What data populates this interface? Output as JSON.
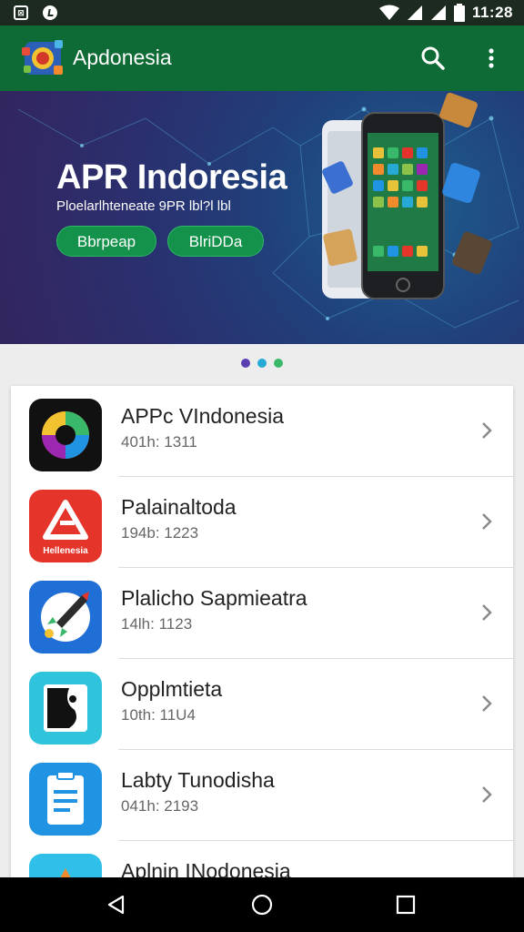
{
  "status_bar": {
    "time": "11:28"
  },
  "app_bar": {
    "title": "Apdonesia"
  },
  "banner": {
    "title": "APR Indoresia",
    "subtitle": "Ploelarlhteneate 9PR lbl?l lbl",
    "button_primary": "Bbrpeap",
    "button_secondary": "BlriDDa"
  },
  "pager": {
    "total": 3,
    "colors": [
      "#5b3fb0",
      "#27a9d6",
      "#3ab86a"
    ]
  },
  "apps": [
    {
      "name": "APPc VIndonesia",
      "meta": "401h: 1311",
      "icon": "colorful-circle-icon",
      "icon_bg": "#111111"
    },
    {
      "name": "Palainaltoda",
      "meta": "194b: 1223",
      "icon": "red-logo-icon",
      "icon_bg": "#e5352b",
      "icon_text": "Hellenesia"
    },
    {
      "name": "Plalicho Sapmieatra",
      "meta": "14lh: 1123",
      "icon": "rocket-icon",
      "icon_bg": "#1f6fd6"
    },
    {
      "name": "Opplmtieta",
      "meta": "10th: 11U4",
      "icon": "black-white-face-icon",
      "icon_bg": "#2fc3dc"
    },
    {
      "name": "Labty Tunodisha",
      "meta": "041h: 2193",
      "icon": "clipboard-icon",
      "icon_bg": "#2193e3"
    },
    {
      "name": "Aplnin INodonesia",
      "meta": "",
      "icon": "orange-triangle-icon",
      "icon_bg": "#2fbfe8"
    }
  ]
}
